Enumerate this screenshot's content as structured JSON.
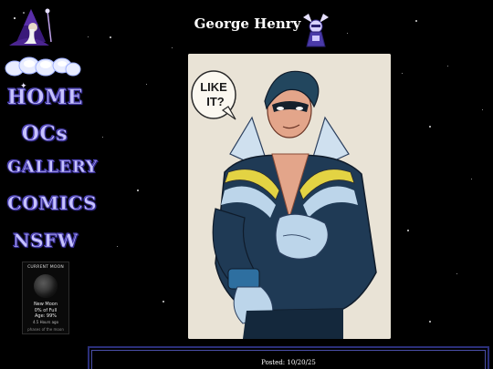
{
  "header": {
    "title": "George Henry"
  },
  "nav": {
    "home": "HOME",
    "ocs": "OCs",
    "gallery": "GALLERY",
    "comics": "COMICS",
    "nsfw": "NSFW"
  },
  "moon": {
    "title": "CURRENT MOON",
    "phase": "New Moon",
    "percent_full": "0% of Full",
    "age": "Age: 99%",
    "extra": "4.5 Hours ago",
    "footer": "phases of the moon"
  },
  "artwork": {
    "speech_line1": "LIKE",
    "speech_line2": "IT?"
  },
  "post": {
    "posted": "Posted: 10/20/25"
  },
  "colors": {
    "background": "#000000",
    "nav_text": "#c7c3ff",
    "nav_outline": "#3b2f9e",
    "box_border": "#2b2f7a"
  }
}
